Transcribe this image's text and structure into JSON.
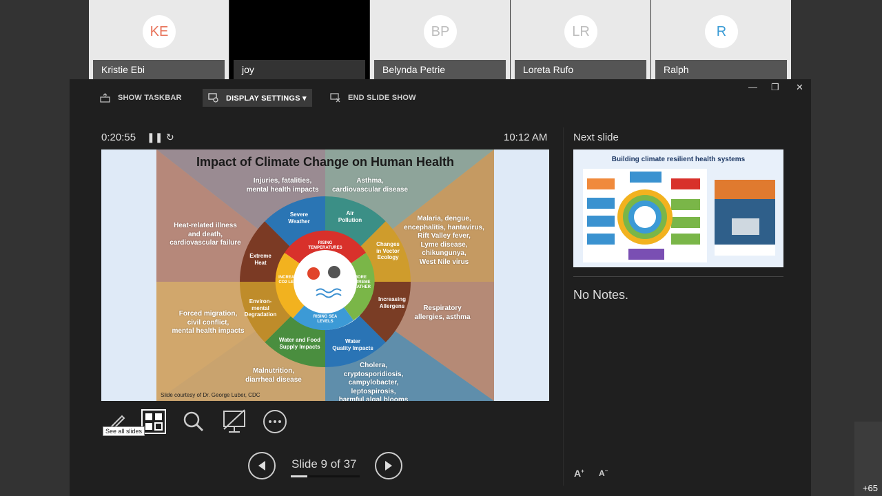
{
  "participants": [
    {
      "initials": "KE",
      "name": "Kristie Ebi",
      "color": "#e8735a"
    },
    {
      "initials": "",
      "name": "joy",
      "color": ""
    },
    {
      "initials": "BP",
      "name": "Belynda Petrie",
      "color": "#bdbdbd"
    },
    {
      "initials": "LR",
      "name": "Loreta Rufo",
      "color": "#bdbdbd"
    },
    {
      "initials": "R",
      "name": "Ralph",
      "color": "#3a9bd5"
    }
  ],
  "overflow_count": "+65",
  "toolbar": {
    "show_taskbar": "SHOW TASKBAR",
    "display_settings": "DISPLAY SETTINGS ▾",
    "end_slide_show": "END SLIDE SHOW"
  },
  "timer": "0:20:55",
  "clock": "10:12 AM",
  "slide": {
    "title": "Impact of Climate Change on Human Health",
    "outer": {
      "injuries": "Injuries, fatalities,\nmental health impacts",
      "asthma": "Asthma,\ncardiovascular disease",
      "heat": "Heat-related illness\nand death,\ncardiovascular failure",
      "malaria": "Malaria, dengue,\nencephalitis, hantavirus,\nRift Valley fever,\nLyme disease,\nchikungunya,\nWest Nile virus",
      "migration": "Forced migration,\ncivil conflict,\nmental health impacts",
      "respiratory": "Respiratory\nallergies, asthma",
      "malnutrition": "Malnutrition,\ndiarrheal disease",
      "cholera": "Cholera,\ncryptosporidiosis,\ncampylobacter, leptospirosis,\nharmful algal blooms"
    },
    "ring": {
      "severe_weather": "Severe\nWeather",
      "air_pollution": "Air\nPollution",
      "vector": "Changes\nin Vector\nEcology",
      "allergens": "Increasing\nAllergens",
      "water_quality": "Water\nQuality Impacts",
      "water_food": "Water and Food\nSupply Impacts",
      "environmental": "Environ-\nmental\nDegradation",
      "extreme_heat": "Extreme\nHeat"
    },
    "center": {
      "rising_temperatures": "RISING TEMPERATURES",
      "more_extreme_weather": "MORE EXTREME WEATHER",
      "rising_sea_levels": "RISING SEA LEVELS",
      "increasing_co2": "INCREASING CO2 LEVELS"
    },
    "courtesy": "Slide courtesy of Dr. George Luber, CDC"
  },
  "tooltip": "See all slides",
  "slide_counter": "Slide 9 of 37",
  "progress_fraction": 0.243,
  "next_slide": {
    "label": "Next slide",
    "title": "Building climate resilient health systems"
  },
  "notes": "No Notes.",
  "font_controls": {
    "increase": "A",
    "decrease": "A"
  }
}
